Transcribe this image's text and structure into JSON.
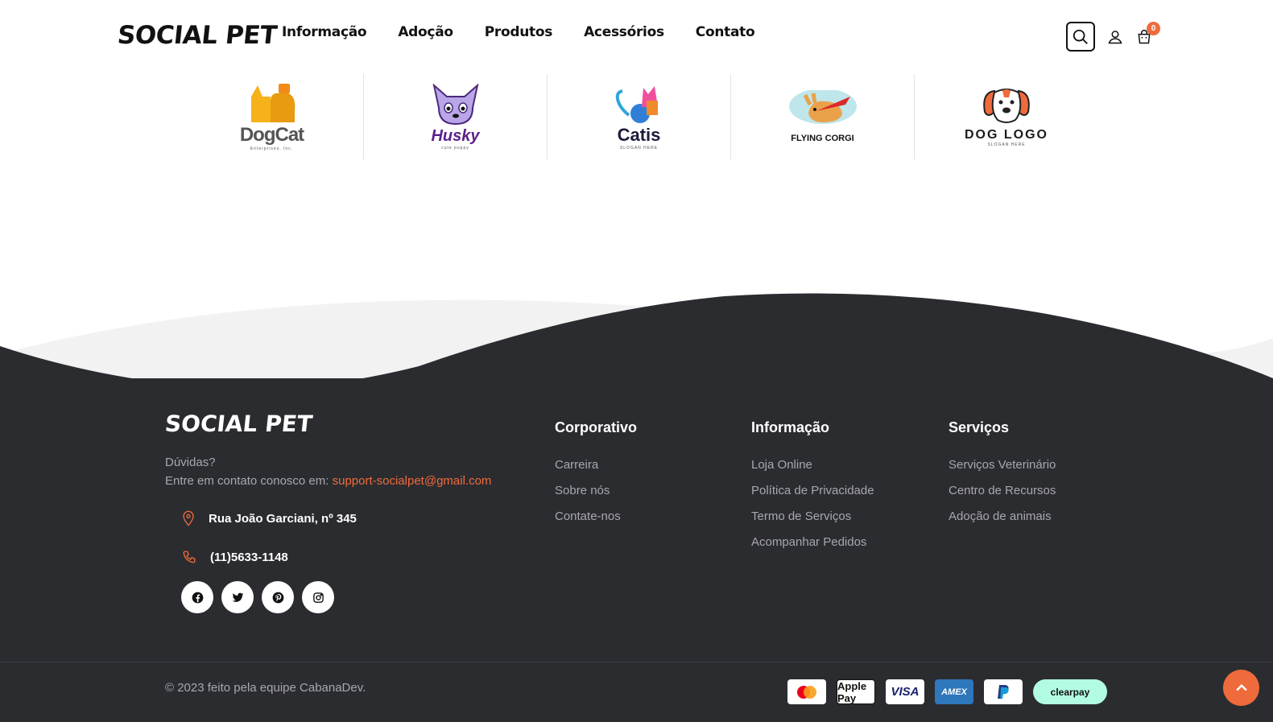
{
  "header": {
    "logo": "SOCIAL PET",
    "nav": [
      "Informação",
      "Adoção",
      "Produtos",
      "Acessórios",
      "Contato"
    ],
    "cart_count": "0",
    "icons": [
      "search-icon",
      "user-icon",
      "cart-icon"
    ]
  },
  "brands": [
    {
      "name": "DogCat",
      "sub": "Enterprises, Inc.",
      "color": "#555555",
      "accent": "#f5b21b"
    },
    {
      "name": "Husky",
      "sub": "cute puppy",
      "color": "#5b1f8a",
      "accent": "#8a5bd6"
    },
    {
      "name": "Catis",
      "sub": "SLOGAN HERE",
      "color": "#1b1b3a",
      "accent": "#ef4f9c"
    },
    {
      "name": "FLYING CORGI",
      "sub": "",
      "color": "#111111",
      "accent": "#e3a04a"
    },
    {
      "name": "DOG LOGO",
      "sub": "SLOGAN HERE",
      "color": "#1b1b1b",
      "accent": "#ef6b3b"
    }
  ],
  "footer": {
    "logo": "SOCIAL PET",
    "question": "Dúvidas?",
    "contact_prefix": "Entre em contato conosco em: ",
    "email": "support-socialpet@gmail.com",
    "address": "Rua João Garciani, nº 345",
    "phone": "(11)5633-1148",
    "socials": [
      "facebook-icon",
      "twitter-icon",
      "pinterest-icon",
      "instagram-icon"
    ],
    "columns": [
      {
        "title": "Corporativo",
        "links": [
          "Carreira",
          "Sobre nós",
          "Contate-nos"
        ]
      },
      {
        "title": "Informação",
        "links": [
          "Loja Online",
          "Política de Privacidade",
          "Termo de Serviços",
          "Acompanhar Pedidos"
        ]
      },
      {
        "title": "Serviços",
        "links": [
          "Serviços Veterinário",
          "Centro de Recursos",
          "Adoção de animais"
        ]
      }
    ],
    "copyright": "© 2023 feito pela equipe CabanaDev.",
    "payments": [
      "mastercard",
      "Apple Pay",
      "VISA",
      "AMEX",
      "PayPal",
      "clearpay"
    ]
  },
  "colors": {
    "accent": "#ef6b3b",
    "footer_bg": "#2b2c30",
    "text_muted": "#a7a7ad"
  }
}
